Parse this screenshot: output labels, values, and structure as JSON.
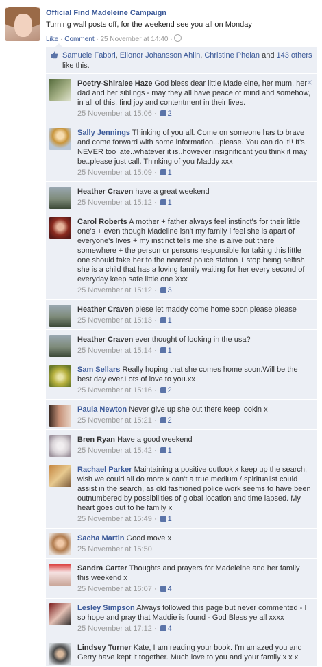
{
  "post": {
    "author": "Official Find Madeleine Campaign",
    "text": "Turning wall posts off, for the weekend see you all on Monday",
    "actions": {
      "like": "Like",
      "comment": "Comment",
      "date": "25 November at 14:40"
    },
    "likes": {
      "names": [
        "Samuele Fabbri",
        "Elionor Johansson Ahlin",
        "Christine Phelan"
      ],
      "others": "143 others",
      "suffix": "like this."
    }
  },
  "comments": [
    {
      "author": "Poetry-Shiralee Haze",
      "text": "God bless dear little Madeleine, her mum, her dad and her siblings - may they all have peace of mind and somehow, in all of this, find joy and contentment in their lives.",
      "date": "25 November at 15:06",
      "likes": "2",
      "avatar": "av-poetry",
      "name_color": "#333"
    },
    {
      "author": "Sally Jennings",
      "text": "Thinking of you all. Come on someone has to brave and come forward with some information...please. You can do it!! It's NEVER too late..whatever it is..however insignificant you think it may be..please just call. Thinking of you Maddy xxx",
      "date": "25 November at 15:09",
      "likes": "1",
      "avatar": "av-sally",
      "name_color": "#3b5998"
    },
    {
      "author": "Heather Craven",
      "text": "have a great weekend",
      "date": "25 November at 15:12",
      "likes": "1",
      "avatar": "av-heather",
      "name_color": "#333"
    },
    {
      "author": "Carol Roberts",
      "text": "A mother + father always feel instinct's for their little one's + even though Madeline isn't my family i feel she is apart of everyone's lives + my instinct tells me she is alive out there somewhere + the person or persons responsible for taking this little one should take her to the nearest police station + stop being selfish she is a child that has a loving family waiting for her every second of everyday keep safe little one Xxx",
      "date": "25 November at 15:12",
      "likes": "3",
      "avatar": "av-carol",
      "name_color": "#333"
    },
    {
      "author": "Heather Craven",
      "text": "plese let maddy come home soon please please",
      "date": "25 November at 15:13",
      "likes": "1",
      "avatar": "av-heather",
      "name_color": "#333"
    },
    {
      "author": "Heather Craven",
      "text": "ever thought of looking in the usa?",
      "date": "25 November at 15:14",
      "likes": "1",
      "avatar": "av-heather",
      "name_color": "#333"
    },
    {
      "author": "Sam Sellars",
      "text": "Really hoping that she comes home soon.Will be the best day ever.Lots of love to you.xx",
      "date": "25 November at 15:16",
      "likes": "2",
      "avatar": "av-sam",
      "name_color": "#3b5998"
    },
    {
      "author": "Paula Newton",
      "text": "Never give up she out there keep lookin x",
      "date": "25 November at 15:21",
      "likes": "2",
      "avatar": "av-paula",
      "name_color": "#3b5998"
    },
    {
      "author": "Bren Ryan",
      "text": "Have a good weekend",
      "date": "25 November at 15:42",
      "likes": "1",
      "avatar": "av-bren",
      "name_color": "#333"
    },
    {
      "author": "Rachael Parker",
      "text": "Maintaining a positive outlook x keep up the search, wish we could all do more x can't a true medium / spiritualist could assist in the search, as old fashioned police work seems to have been outnumbered by possibilities of global location and time lapsed. My heart goes out to he family x",
      "date": "25 November at 15:49",
      "likes": "1",
      "avatar": "av-rachael",
      "name_color": "#3b5998"
    },
    {
      "author": "Sacha Martin",
      "text": "Good move x",
      "date": "25 November at 15:50",
      "likes": "",
      "avatar": "av-sacha",
      "name_color": "#3b5998"
    },
    {
      "author": "Sandra Carter",
      "text": "Thoughts and prayers for Madeleine and her family this weekend x",
      "date": "25 November at 16:07",
      "likes": "4",
      "avatar": "av-sandra",
      "name_color": "#333"
    },
    {
      "author": "Lesley Simpson",
      "text": "Always followed this page but never commented - I so hope and pray that Maddie is found - God Bless ye all xxxx",
      "date": "25 November at 17:12",
      "likes": "4",
      "avatar": "av-lesley",
      "name_color": "#3b5998"
    },
    {
      "author": "Lindsey Turner",
      "text": "Kate, I am reading your book. I'm amazed you and Gerry have kept it together. Much love to you and your family x x x",
      "date": "",
      "likes": "",
      "avatar": "av-lindsey",
      "name_color": "#333"
    }
  ],
  "icons": {
    "like": "thumbs-up-icon",
    "remove": "close-icon",
    "privacy": "globe-icon"
  }
}
